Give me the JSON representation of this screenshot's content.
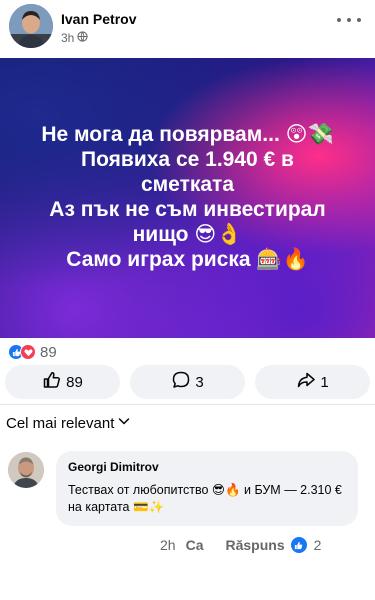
{
  "post": {
    "author": "Ivan Petrov",
    "time": "3h",
    "visibility_icon": "globe-icon",
    "banner_lines": [
      "Не мога да повярвам... 😲💸",
      "Появиха се 1.940 € в",
      "сметката",
      "Аз пък не съм инвестирал",
      "нищо 😎👌",
      "Само играх риска 🎰🔥"
    ],
    "reactions_total": "89"
  },
  "actions": {
    "like_count": "89",
    "comment_count": "3",
    "share_count": "1"
  },
  "sort": {
    "label": "Cel mai relevant"
  },
  "comment": {
    "author": "Georgi Dimitrov",
    "text": "Тествах от любопитство 😎🔥 и БУМ — 2.310 € на картата 💳✨",
    "time": "2h",
    "like_label": "Ca",
    "reply_label": "Răspuns",
    "like_count": "2"
  },
  "colors": {
    "facebook_blue": "#1877f2",
    "love_red": "#f33e58",
    "pill_bg": "#f0f2f5",
    "muted_text": "#65676b"
  }
}
